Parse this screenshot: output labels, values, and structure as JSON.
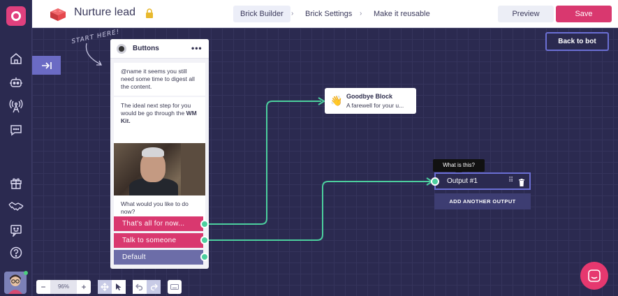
{
  "header": {
    "title": "Nurture lead",
    "breadcrumbs": [
      {
        "label": "Brick Builder"
      },
      {
        "label": "Brick Settings"
      },
      {
        "label": "Make it reusable"
      }
    ],
    "preview_label": "Preview",
    "save_label": "Save"
  },
  "sidebar": {
    "icons": [
      "home-icon",
      "bot-icon",
      "broadcast-icon",
      "chat-icon",
      "gift-icon",
      "handshake-icon",
      "feedback-icon",
      "help-icon"
    ]
  },
  "canvas": {
    "start_hint": "START HERE!",
    "back_to_bot_label": "Back to bot",
    "buttons_card": {
      "title": "Buttons",
      "menu": "•••",
      "message_1": "@name it seems you still need some time to digest all the content.",
      "message_2_prefix": "The ideal next step for you would be go through the ",
      "message_2_bold": "WM Kit.",
      "message_3": "What would you like to do now?",
      "buttons": [
        {
          "label": "That's all for now..."
        },
        {
          "label": "Talk to someone"
        },
        {
          "label": "Default"
        }
      ]
    },
    "goodbye_card": {
      "emoji": "👋",
      "title": "Goodbye Block",
      "description": "A farewell for your u..."
    },
    "output": {
      "tooltip": "What is this?",
      "label": "Output #1",
      "add_label": "ADD ANOTHER OUTPUT"
    },
    "toolbar": {
      "zoom": "96%",
      "zoom_out": "−",
      "zoom_in": "+"
    }
  },
  "colors": {
    "canvas_bg": "#2b2a50",
    "accent_pink": "#d9386f",
    "accent_purple": "#6b6fd4",
    "connector_green": "#4ccf9e"
  }
}
